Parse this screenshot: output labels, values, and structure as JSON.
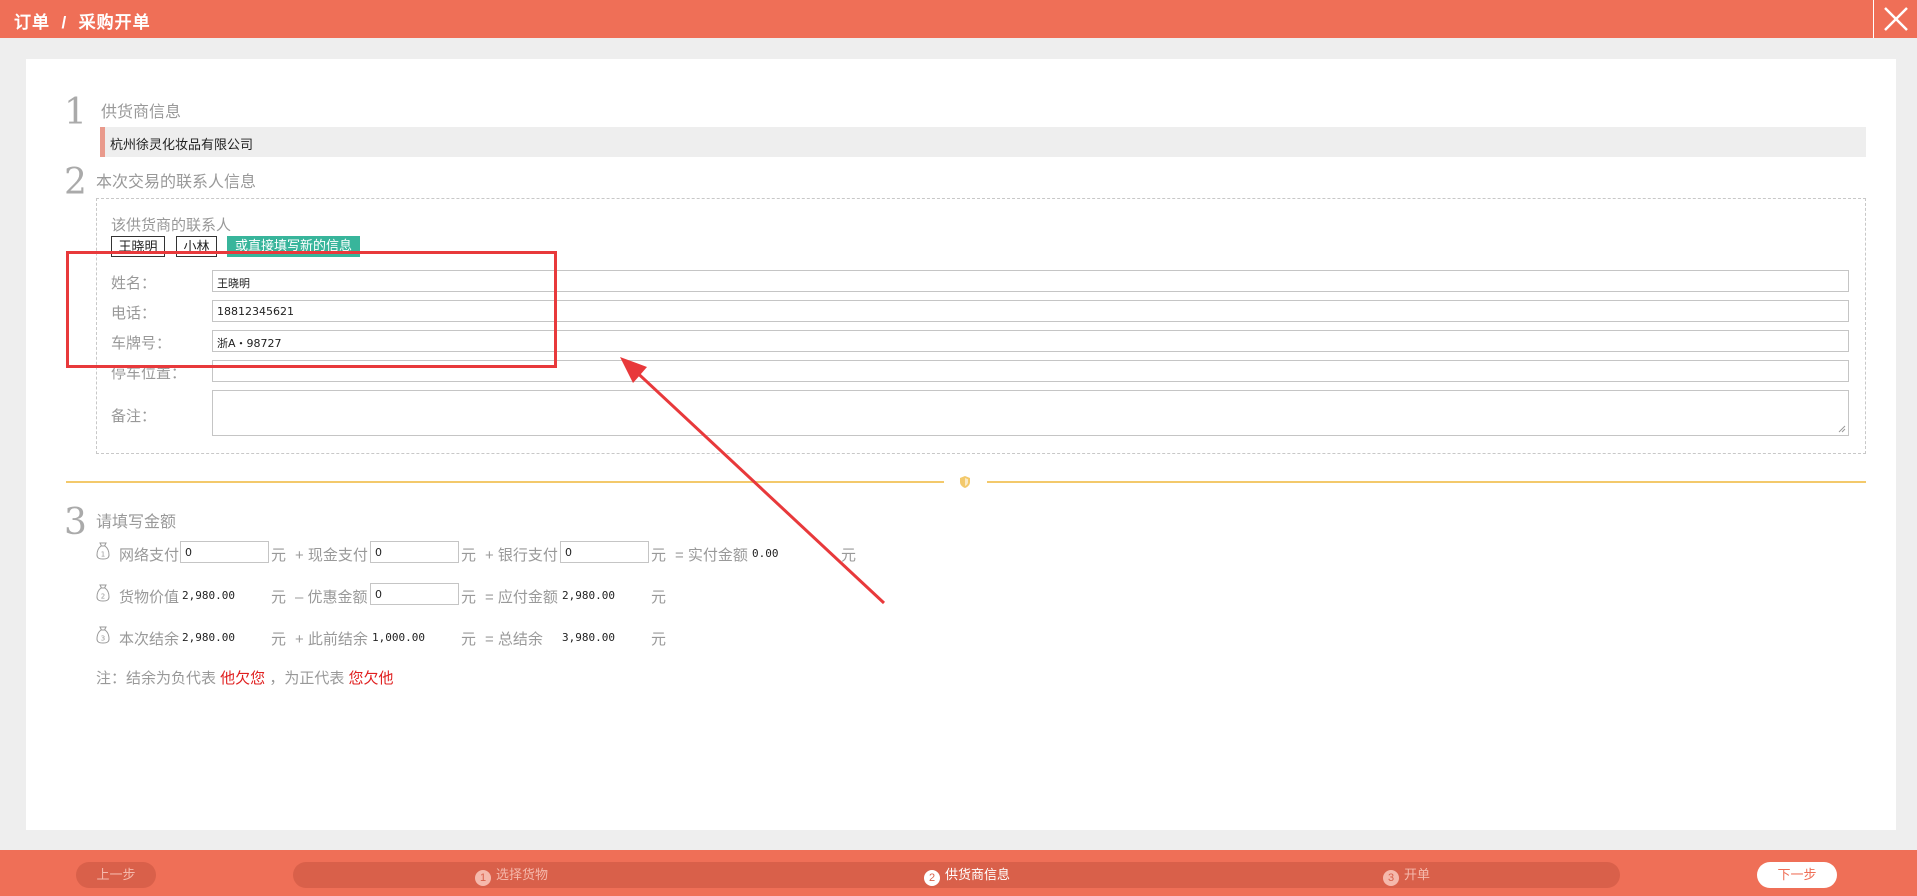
{
  "header": {
    "breadcrumb": "订单  /  采购开单",
    "close_icon": "close-icon"
  },
  "step1": {
    "number": "1",
    "title": "供货商信息",
    "supplier_name": "杭州徐灵化妆品有限公司"
  },
  "step2": {
    "number": "2",
    "title": "本次交易的联系人信息",
    "contacts_label": "该供货商的联系人",
    "contacts": [
      "王晓明",
      "小林"
    ],
    "new_info_button": "或直接填写新的信息",
    "fields": {
      "name": {
        "label": "姓名：",
        "value": "王晓明"
      },
      "phone": {
        "label": "电话：",
        "value": "18812345621"
      },
      "plate": {
        "label": "车牌号：",
        "value": "浙A・98727"
      },
      "parking": {
        "label": "停车位置：",
        "value": ""
      },
      "remark": {
        "label": "备注：",
        "value": ""
      }
    }
  },
  "step3": {
    "number": "3",
    "title": "请填写金额",
    "row1": {
      "online_label": "网络支付",
      "online_value": "0",
      "cash_label": "+ 现金支付",
      "cash_value": "0",
      "bank_label": "+ 银行支付",
      "bank_value": "0",
      "paid_label": "= 实付金额",
      "paid_value": "0.00"
    },
    "row2": {
      "goods_label": "货物价值",
      "goods_value": "2,980.00",
      "discount_label": "– 优惠金额",
      "discount_value": "0",
      "payable_label": "= 应付金额",
      "payable_value": "2,980.00"
    },
    "row3": {
      "balance_label": "本次结余",
      "balance_value": "2,980.00",
      "prev_label": "+ 此前结余",
      "prev_value": "1,000.00",
      "total_label": "= 总结余",
      "total_value": "3,980.00"
    },
    "unit": "元",
    "note_prefix": "注：结余为负代表 ",
    "note_neg": "他欠您",
    "note_mid": " ，为正代表 ",
    "note_pos": "您欠他"
  },
  "footer": {
    "prev_button": "上一步",
    "next_button": "下一步",
    "steps": [
      {
        "num": "1",
        "label": "选择货物",
        "active": false
      },
      {
        "num": "2",
        "label": "供货商信息",
        "active": true
      },
      {
        "num": "3",
        "label": "开单",
        "active": false
      }
    ]
  },
  "colors": {
    "brand": "#ef6f57",
    "accent_green": "#38b59b",
    "divider": "#f3c96b",
    "warning_red": "#e02020",
    "annotation_red": "#e8393b"
  }
}
